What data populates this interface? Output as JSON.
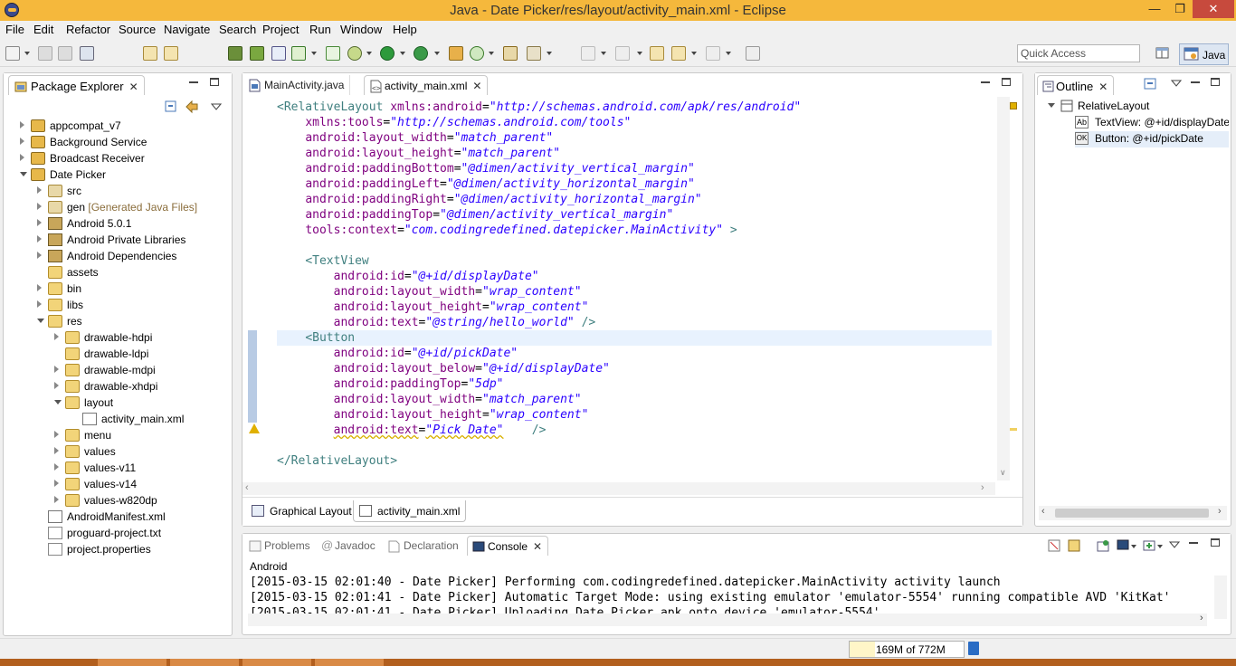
{
  "window": {
    "title": "Java - Date Picker/res/layout/activity_main.xml - Eclipse"
  },
  "menu": [
    "File",
    "Edit",
    "Refactor",
    "Source",
    "Navigate",
    "Search",
    "Project",
    "Run",
    "Window",
    "Help"
  ],
  "quick_access": {
    "placeholder": "Quick Access"
  },
  "perspective": {
    "label": "Java"
  },
  "package_explorer": {
    "title": "Package Explorer",
    "items": [
      {
        "label": "appcompat_v7",
        "depth": 0,
        "state": "closed",
        "icon": "project-folder-icon"
      },
      {
        "label": "Background Service",
        "depth": 0,
        "state": "closed",
        "icon": "project-folder-icon"
      },
      {
        "label": "Broadcast Receiver",
        "depth": 0,
        "state": "closed",
        "icon": "project-folder-icon"
      },
      {
        "label": "Date Picker",
        "depth": 0,
        "state": "open",
        "icon": "project-folder-icon"
      },
      {
        "label": "src",
        "depth": 1,
        "state": "closed",
        "icon": "source-folder-icon"
      },
      {
        "label": "gen",
        "depth": 1,
        "state": "closed",
        "icon": "source-folder-icon",
        "suffix": "[Generated Java Files]"
      },
      {
        "label": "Android 5.0.1",
        "depth": 1,
        "state": "closed",
        "icon": "library-icon"
      },
      {
        "label": "Android Private Libraries",
        "depth": 1,
        "state": "closed",
        "icon": "library-icon"
      },
      {
        "label": "Android Dependencies",
        "depth": 1,
        "state": "closed",
        "icon": "library-icon"
      },
      {
        "label": "assets",
        "depth": 1,
        "state": "none",
        "icon": "folder-icon"
      },
      {
        "label": "bin",
        "depth": 1,
        "state": "closed",
        "icon": "folder-icon"
      },
      {
        "label": "libs",
        "depth": 1,
        "state": "closed",
        "icon": "folder-icon"
      },
      {
        "label": "res",
        "depth": 1,
        "state": "open",
        "icon": "folder-icon"
      },
      {
        "label": "drawable-hdpi",
        "depth": 2,
        "state": "closed",
        "icon": "folder-icon"
      },
      {
        "label": "drawable-ldpi",
        "depth": 2,
        "state": "none",
        "icon": "folder-icon"
      },
      {
        "label": "drawable-mdpi",
        "depth": 2,
        "state": "closed",
        "icon": "folder-icon"
      },
      {
        "label": "drawable-xhdpi",
        "depth": 2,
        "state": "closed",
        "icon": "folder-icon"
      },
      {
        "label": "layout",
        "depth": 2,
        "state": "open",
        "icon": "folder-icon"
      },
      {
        "label": "activity_main.xml",
        "depth": 3,
        "state": "none",
        "icon": "xml-file-icon"
      },
      {
        "label": "menu",
        "depth": 2,
        "state": "closed",
        "icon": "folder-icon"
      },
      {
        "label": "values",
        "depth": 2,
        "state": "closed",
        "icon": "folder-icon"
      },
      {
        "label": "values-v11",
        "depth": 2,
        "state": "closed",
        "icon": "folder-icon"
      },
      {
        "label": "values-v14",
        "depth": 2,
        "state": "closed",
        "icon": "folder-icon"
      },
      {
        "label": "values-w820dp",
        "depth": 2,
        "state": "closed",
        "icon": "folder-icon"
      },
      {
        "label": "AndroidManifest.xml",
        "depth": 1,
        "state": "none",
        "icon": "xml-file-icon"
      },
      {
        "label": "proguard-project.txt",
        "depth": 1,
        "state": "none",
        "icon": "text-file-icon"
      },
      {
        "label": "project.properties",
        "depth": 1,
        "state": "none",
        "icon": "text-file-icon"
      }
    ]
  },
  "editor": {
    "tabs": [
      {
        "label": "MainActivity.java",
        "active": false
      },
      {
        "label": "activity_main.xml",
        "active": true
      }
    ],
    "lines": [
      {
        "indent": 0,
        "parts": [
          [
            "tag",
            "<RelativeLayout "
          ],
          [
            "attr",
            "xmlns:android"
          ],
          [
            "punc",
            "="
          ],
          [
            "str",
            "\"http://schemas.android.com/apk/res/android\""
          ]
        ]
      },
      {
        "indent": 4,
        "parts": [
          [
            "attr",
            "xmlns:tools"
          ],
          [
            "punc",
            "="
          ],
          [
            "str",
            "\"http://schemas.android.com/tools\""
          ]
        ]
      },
      {
        "indent": 4,
        "parts": [
          [
            "attr",
            "android:layout_width"
          ],
          [
            "punc",
            "="
          ],
          [
            "str",
            "\"match_parent\""
          ]
        ]
      },
      {
        "indent": 4,
        "parts": [
          [
            "attr",
            "android:layout_height"
          ],
          [
            "punc",
            "="
          ],
          [
            "str",
            "\"match_parent\""
          ]
        ]
      },
      {
        "indent": 4,
        "parts": [
          [
            "attr",
            "android:paddingBottom"
          ],
          [
            "punc",
            "="
          ],
          [
            "str",
            "\"@dimen/activity_vertical_margin\""
          ]
        ]
      },
      {
        "indent": 4,
        "parts": [
          [
            "attr",
            "android:paddingLeft"
          ],
          [
            "punc",
            "="
          ],
          [
            "str",
            "\"@dimen/activity_horizontal_margin\""
          ]
        ]
      },
      {
        "indent": 4,
        "parts": [
          [
            "attr",
            "android:paddingRight"
          ],
          [
            "punc",
            "="
          ],
          [
            "str",
            "\"@dimen/activity_horizontal_margin\""
          ]
        ]
      },
      {
        "indent": 4,
        "parts": [
          [
            "attr",
            "android:paddingTop"
          ],
          [
            "punc",
            "="
          ],
          [
            "str",
            "\"@dimen/activity_vertical_margin\""
          ]
        ]
      },
      {
        "indent": 4,
        "parts": [
          [
            "attr",
            "tools:context"
          ],
          [
            "punc",
            "="
          ],
          [
            "str",
            "\"com.codingredefined.datepicker.MainActivity\""
          ],
          [
            "tag",
            " >"
          ]
        ]
      },
      {
        "indent": 0,
        "parts": []
      },
      {
        "indent": 4,
        "parts": [
          [
            "tag",
            "<TextView"
          ]
        ]
      },
      {
        "indent": 8,
        "parts": [
          [
            "attr",
            "android:id"
          ],
          [
            "punc",
            "="
          ],
          [
            "str",
            "\"@+id/displayDate\""
          ]
        ]
      },
      {
        "indent": 8,
        "parts": [
          [
            "attr",
            "android:layout_width"
          ],
          [
            "punc",
            "="
          ],
          [
            "str",
            "\"wrap_content\""
          ]
        ]
      },
      {
        "indent": 8,
        "parts": [
          [
            "attr",
            "android:layout_height"
          ],
          [
            "punc",
            "="
          ],
          [
            "str",
            "\"wrap_content\""
          ]
        ]
      },
      {
        "indent": 8,
        "parts": [
          [
            "attr",
            "android:text"
          ],
          [
            "punc",
            "="
          ],
          [
            "str",
            "\"@string/hello_world\""
          ],
          [
            "tag",
            " />"
          ]
        ]
      },
      {
        "indent": 4,
        "parts": [
          [
            "tag",
            "<Button"
          ]
        ],
        "current": true
      },
      {
        "indent": 8,
        "parts": [
          [
            "attr",
            "android:id"
          ],
          [
            "punc",
            "="
          ],
          [
            "str",
            "\"@+id/pickDate\""
          ]
        ]
      },
      {
        "indent": 8,
        "parts": [
          [
            "attr",
            "android:layout_below"
          ],
          [
            "punc",
            "="
          ],
          [
            "str",
            "\"@+id/displayDate\""
          ]
        ]
      },
      {
        "indent": 8,
        "parts": [
          [
            "attr",
            "android:paddingTop"
          ],
          [
            "punc",
            "="
          ],
          [
            "str",
            "\"5dp\""
          ]
        ]
      },
      {
        "indent": 8,
        "parts": [
          [
            "attr",
            "android:layout_width"
          ],
          [
            "punc",
            "="
          ],
          [
            "str",
            "\"match_parent\""
          ]
        ]
      },
      {
        "indent": 8,
        "parts": [
          [
            "attr",
            "android:layout_height"
          ],
          [
            "punc",
            "="
          ],
          [
            "str",
            "\"wrap_content\""
          ]
        ]
      },
      {
        "indent": 8,
        "parts": [
          [
            "attr",
            "android:text"
          ],
          [
            "punc",
            "="
          ],
          [
            "str",
            "\"Pick Date\""
          ],
          [
            "tag",
            "    />"
          ]
        ],
        "warning": true
      },
      {
        "indent": 0,
        "parts": []
      },
      {
        "indent": 0,
        "parts": [
          [
            "tag",
            "</RelativeLayout>"
          ]
        ]
      }
    ],
    "bottom_tabs": [
      {
        "label": "Graphical Layout",
        "active": false
      },
      {
        "label": "activity_main.xml",
        "active": true
      }
    ]
  },
  "outline": {
    "title": "Outline",
    "root": "RelativeLayout",
    "children": [
      {
        "label": "TextView: @+id/displayDate",
        "icon": "textview-icon"
      },
      {
        "label": "Button: @+id/pickDate",
        "icon": "button-icon"
      }
    ]
  },
  "console": {
    "tabs": [
      {
        "label": "Problems",
        "active": false
      },
      {
        "label": "Javadoc",
        "active": false
      },
      {
        "label": "Declaration",
        "active": false
      },
      {
        "label": "Console",
        "active": true
      }
    ],
    "header": "Android",
    "lines": [
      "[2015-03-15 02:01:40 - Date Picker] Performing com.codingredefined.datepicker.MainActivity activity launch",
      "[2015-03-15 02:01:41 - Date Picker] Automatic Target Mode: using existing emulator 'emulator-5554' running compatible AVD 'KitKat'",
      "[2015-03-15 02:01:41 - Date Picker] Uploading Date Picker.apk onto device 'emulator-5554'"
    ]
  },
  "status": {
    "heap_label": "169M of 772M",
    "heap_used_fraction": 0.22
  },
  "colors": {
    "titlebar": "#f5b83c",
    "close_button": "#c74a3d",
    "xml_tag": "#3f7f7f",
    "xml_attr": "#7f007f",
    "xml_string": "#2a00ff",
    "current_line": "#e8f2fe"
  }
}
